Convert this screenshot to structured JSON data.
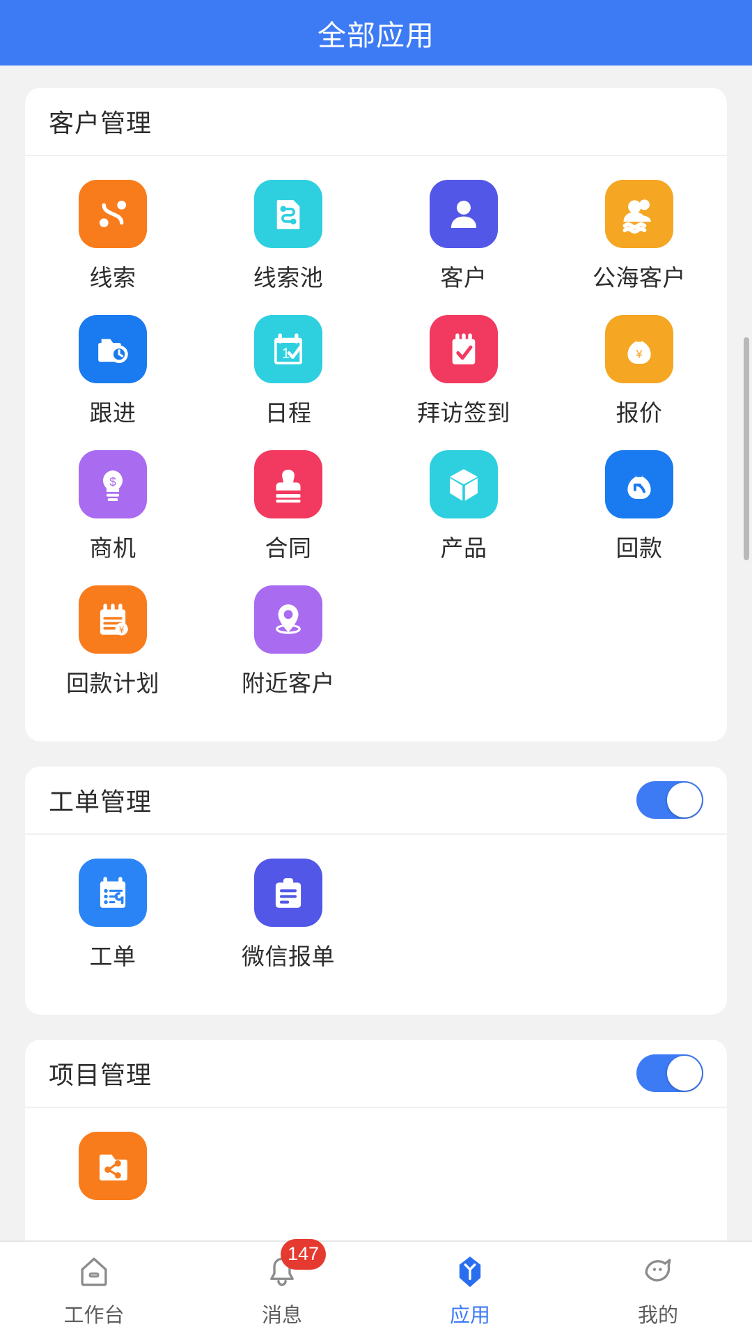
{
  "header": {
    "title": "全部应用",
    "bg_color": "#3d7bf5"
  },
  "sections": [
    {
      "title": "客户管理",
      "has_toggle": false,
      "apps": [
        {
          "label": "线索",
          "icon": "route-icon",
          "color": "#f97c1c"
        },
        {
          "label": "线索池",
          "icon": "lead-pool-doc-icon",
          "color": "#2ed0e0"
        },
        {
          "label": "客户",
          "icon": "person-icon",
          "color": "#5257e8"
        },
        {
          "label": "公海客户",
          "icon": "group-waves-icon",
          "color": "#f5a623"
        },
        {
          "label": "跟进",
          "icon": "folder-clock-icon",
          "color": "#1a7af0"
        },
        {
          "label": "日程",
          "icon": "calendar-check-icon",
          "color": "#2ed0e0"
        },
        {
          "label": "拜访签到",
          "icon": "clipboard-check-icon",
          "color": "#f2395f"
        },
        {
          "label": "报价",
          "icon": "money-bag-yen-icon",
          "color": "#f5a623"
        },
        {
          "label": "商机",
          "icon": "bulb-dollar-icon",
          "color": "#a96bf0"
        },
        {
          "label": "合同",
          "icon": "stamp-icon",
          "color": "#f2395f"
        },
        {
          "label": "产品",
          "icon": "cube-icon",
          "color": "#2ed0e0"
        },
        {
          "label": "回款",
          "icon": "money-bag-back-icon",
          "color": "#1a7af0"
        },
        {
          "label": "回款计划",
          "icon": "note-yen-icon",
          "color": "#f97c1c"
        },
        {
          "label": "附近客户",
          "icon": "location-pin-icon",
          "color": "#a96bf0"
        }
      ]
    },
    {
      "title": "工单管理",
      "has_toggle": true,
      "toggle_on": true,
      "apps": [
        {
          "label": "工单",
          "icon": "clipboard-wrench-icon",
          "color": "#2a84f5"
        },
        {
          "label": "微信报单",
          "icon": "clipboard-lines-icon",
          "color": "#5257e8"
        }
      ]
    },
    {
      "title": "项目管理",
      "has_toggle": true,
      "toggle_on": true,
      "apps": [
        {
          "label": "",
          "icon": "folder-share-icon",
          "color": "#f97c1c"
        }
      ]
    }
  ],
  "tabbar": {
    "items": [
      {
        "label": "工作台",
        "icon": "home-icon",
        "active": false,
        "badge": ""
      },
      {
        "label": "消息",
        "icon": "bell-icon",
        "active": false,
        "badge": "147"
      },
      {
        "label": "应用",
        "icon": "apps-icon",
        "active": true,
        "badge": ""
      },
      {
        "label": "我的",
        "icon": "profile-icon",
        "active": false,
        "badge": ""
      }
    ],
    "active_color": "#3d7bf5",
    "badge_color": "#e53a30"
  }
}
